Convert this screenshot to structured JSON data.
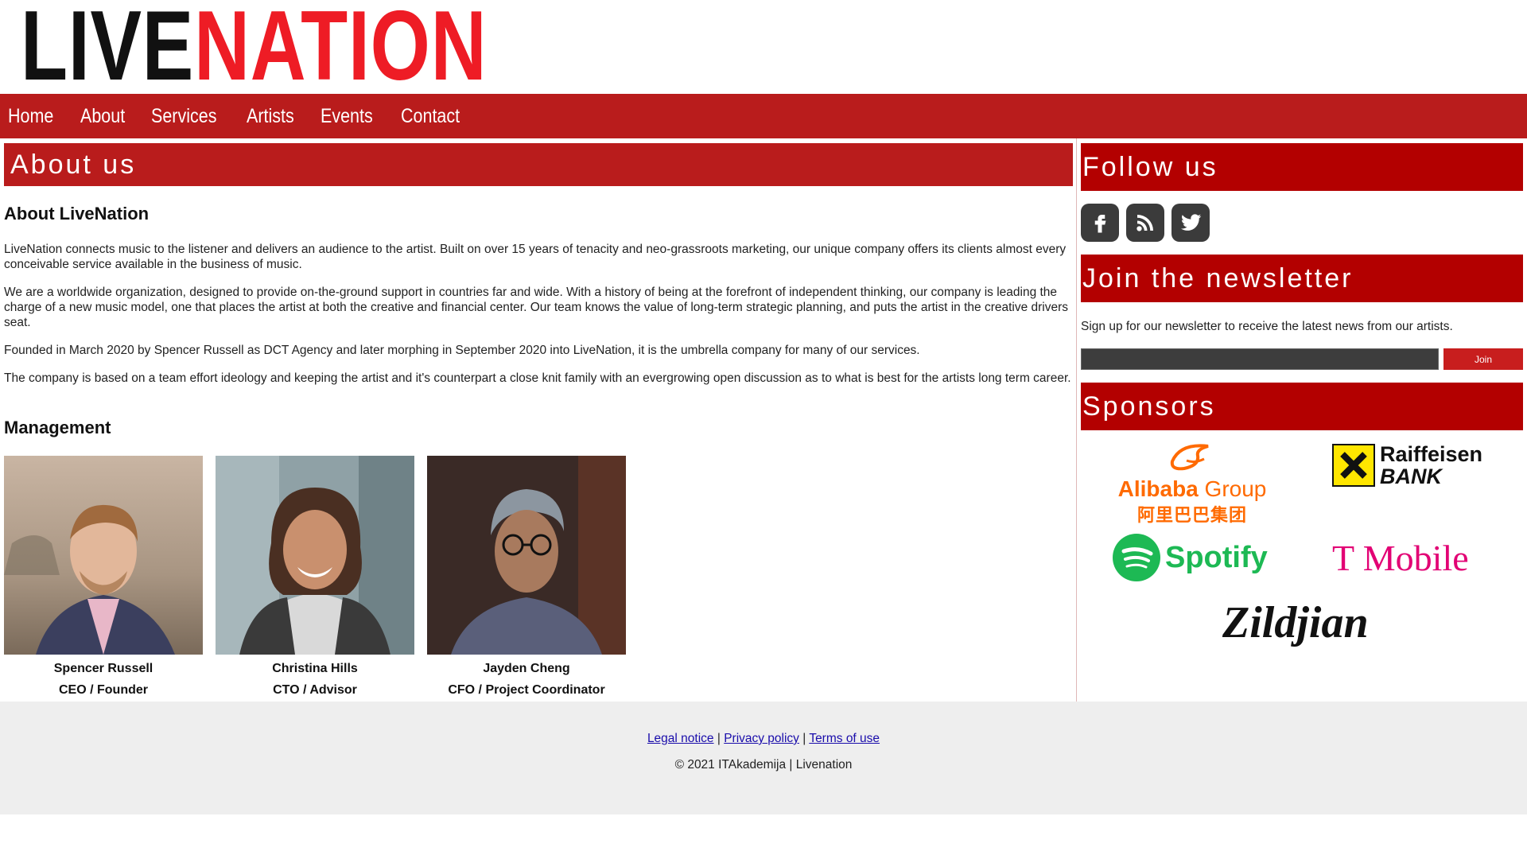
{
  "brand": {
    "live": "LIVE",
    "nation": "NATION"
  },
  "nav": {
    "items": [
      "Home",
      "About",
      "Services",
      "Artists",
      "Events",
      "Contact"
    ]
  },
  "main": {
    "title": "About us",
    "about_heading": "About LiveNation",
    "paragraphs": [
      "LiveNation connects music to the listener and delivers an audience to the artist. Built on over 15 years of tenacity and neo-grassroots marketing, our unique company offers its clients almost every conceivable service available in the business of music.",
      "We are a worldwide organization, designed to provide on-the-ground support in countries far and wide. With a history of being at the forefront of independent thinking, our company is leading the charge of a new music model, one that places the artist at both the creative and financial center. Our team knows the value of long-term strategic planning, and puts the artist in the creative drivers seat.",
      "Founded in March 2020 by Spencer Russell as DCT Agency and later morphing in September 2020 into LiveNation, it is the umbrella company for many of our services.",
      "The company is based on a team effort ideology and keeping the artist and it's counterpart a close knit family with an evergrowing open discussion as to what is best for the artists long term career."
    ],
    "management_heading": "Management",
    "people": [
      {
        "name": "Spencer Russell",
        "role": "CEO / Founder"
      },
      {
        "name": "Christina Hills",
        "role": "CTO / Advisor"
      },
      {
        "name": "Jayden Cheng",
        "role": "CFO / Project Coordinator"
      }
    ]
  },
  "sidebar": {
    "follow_title": "Follow us",
    "social": [
      "facebook-icon",
      "rss-icon",
      "twitter-icon"
    ],
    "newsletter_title": "Join the newsletter",
    "newsletter_text": "Sign up for our newsletter to receive the latest news from our artists.",
    "newsletter_input_value": "",
    "newsletter_button": "Join",
    "sponsors_title": "Sponsors",
    "sponsors": {
      "alibaba": "Alibaba",
      "alibaba_group": "Group",
      "alibaba_cn": "阿里巴巴集团",
      "raiffeisen_1": "Raiffeisen",
      "raiffeisen_2": "BANK",
      "spotify": "Spotify",
      "tmobile": "T Mobile",
      "zildjian": "Zildjian"
    }
  },
  "footer": {
    "links": [
      "Legal notice",
      "Privacy policy",
      "Terms of use"
    ],
    "separator": "|",
    "copyright": "© 2021 ITAkademija | Livenation"
  },
  "colors": {
    "brand_red": "#b91c1c",
    "logo_red": "#ee1c25",
    "sidebar_red": "#b30000"
  }
}
